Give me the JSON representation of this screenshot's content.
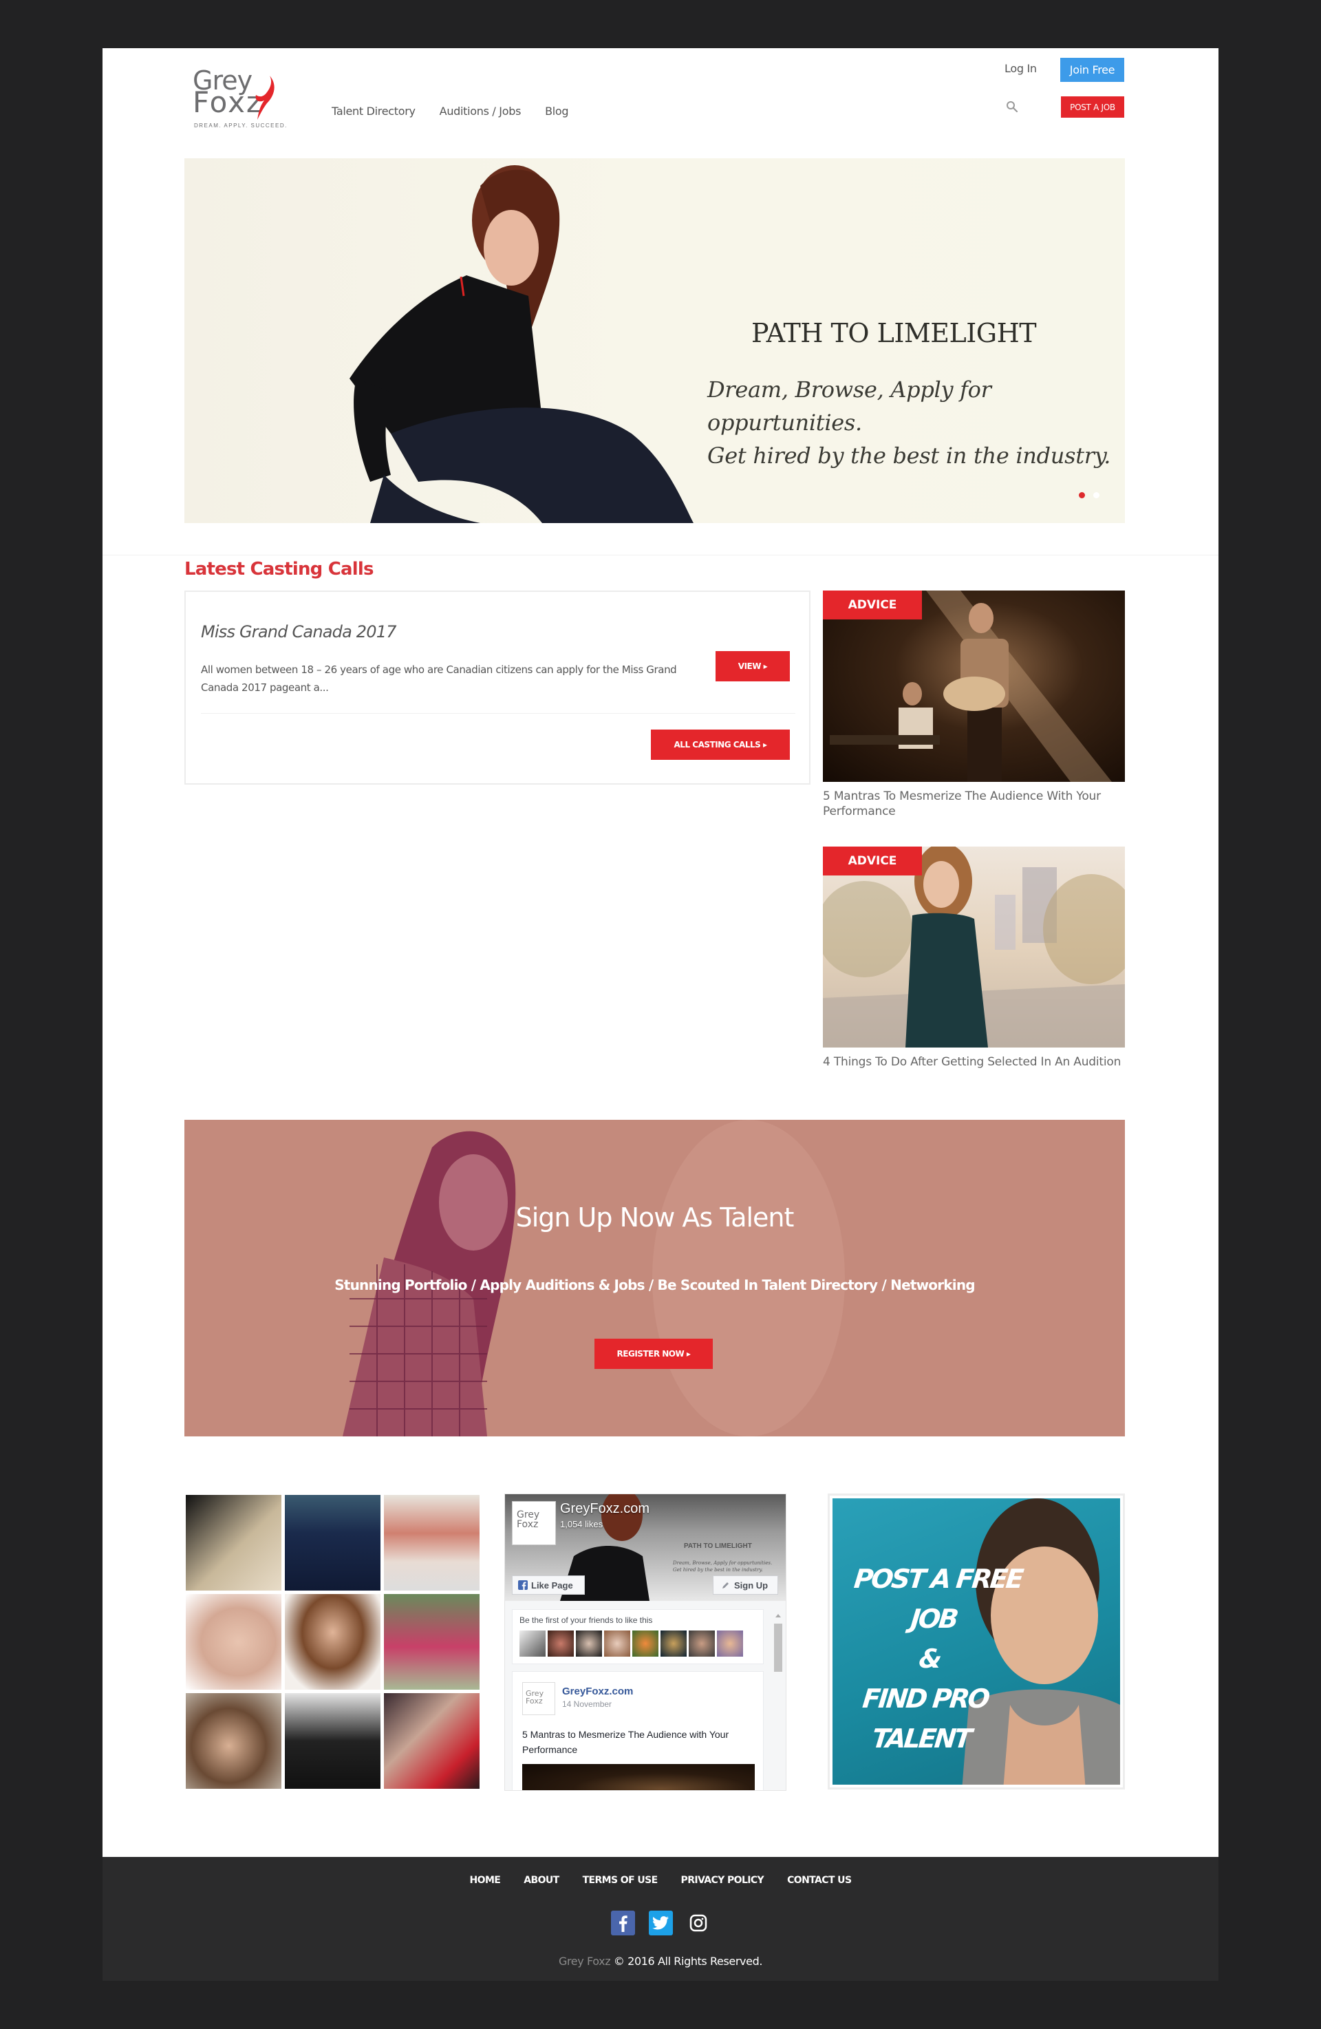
{
  "brand": {
    "logo_line1": "Grey",
    "logo_line2": "Foxz",
    "tagline": "DREAM. APPLY. SUCCEED.",
    "accent_red": "#e4262b",
    "accent_blue": "#3d9be9"
  },
  "nav": {
    "items": [
      {
        "label": "Talent Directory"
      },
      {
        "label": "Auditions / Jobs"
      },
      {
        "label": "Blog"
      }
    ]
  },
  "header": {
    "login_label": "Log In",
    "join_label": "Join Free",
    "post_job_label": "POST A JOB",
    "search_icon": "search-icon"
  },
  "hero": {
    "title": "PATH TO LIMELIGHT",
    "line1": "Dream, Browse, Apply for oppurtunities.",
    "line2": "Get hired by the best in the industry.",
    "slides": 2,
    "active_slide": 1
  },
  "casting": {
    "section_title": "Latest Casting Calls",
    "items": [
      {
        "title": "Miss Grand Canada 2017",
        "description": "All women between 18 – 26 years of age who are Canadian citizens can apply for the Miss Grand Canada 2017 pageant a...",
        "button": "VIEW ▸"
      }
    ],
    "all_button": "ALL CASTING CALLS ▸"
  },
  "advice": [
    {
      "badge": "ADVICE",
      "title": "5 Mantras To Mesmerize The Audience With Your Performance"
    },
    {
      "badge": "ADVICE",
      "title": "4 Things To Do After Getting Selected In An Audition"
    }
  ],
  "signup": {
    "title": "Sign Up Now As Talent",
    "subtitle": "Stunning Portfolio / Apply Auditions & Jobs / Be Scouted In Talent Directory / Networking",
    "button": "REGISTER NOW ▸"
  },
  "facebook": {
    "page_name": "GreyFoxz.com",
    "likes": "1,054 likes",
    "cover_title": "PATH TO LIMELIGHT",
    "cover_line1": "Dream, Browse, Apply for oppurtunities.",
    "cover_line2": "Get hired by the best in the industry.",
    "like_button": "Like Page",
    "signup_button": "Sign Up",
    "friends_text": "Be the first of your friends to like this",
    "post": {
      "author": "GreyFoxz.com",
      "date": "14 November",
      "text": "5 Mantras to Mesmerize The Audience with Your Performance"
    }
  },
  "promo": {
    "line1": "POST A FREE JOB",
    "line2": "&",
    "line3": "FIND PRO TALENT"
  },
  "footer": {
    "links": [
      {
        "label": "HOME"
      },
      {
        "label": "ABOUT"
      },
      {
        "label": "TERMS OF USE"
      },
      {
        "label": "PRIVACY POLICY"
      },
      {
        "label": "CONTACT US"
      }
    ],
    "social": [
      "facebook-icon",
      "twitter-icon",
      "instagram-icon"
    ],
    "copyright_brand": "Grey Foxz",
    "copyright_text": " © 2016 All Rights Reserved."
  }
}
